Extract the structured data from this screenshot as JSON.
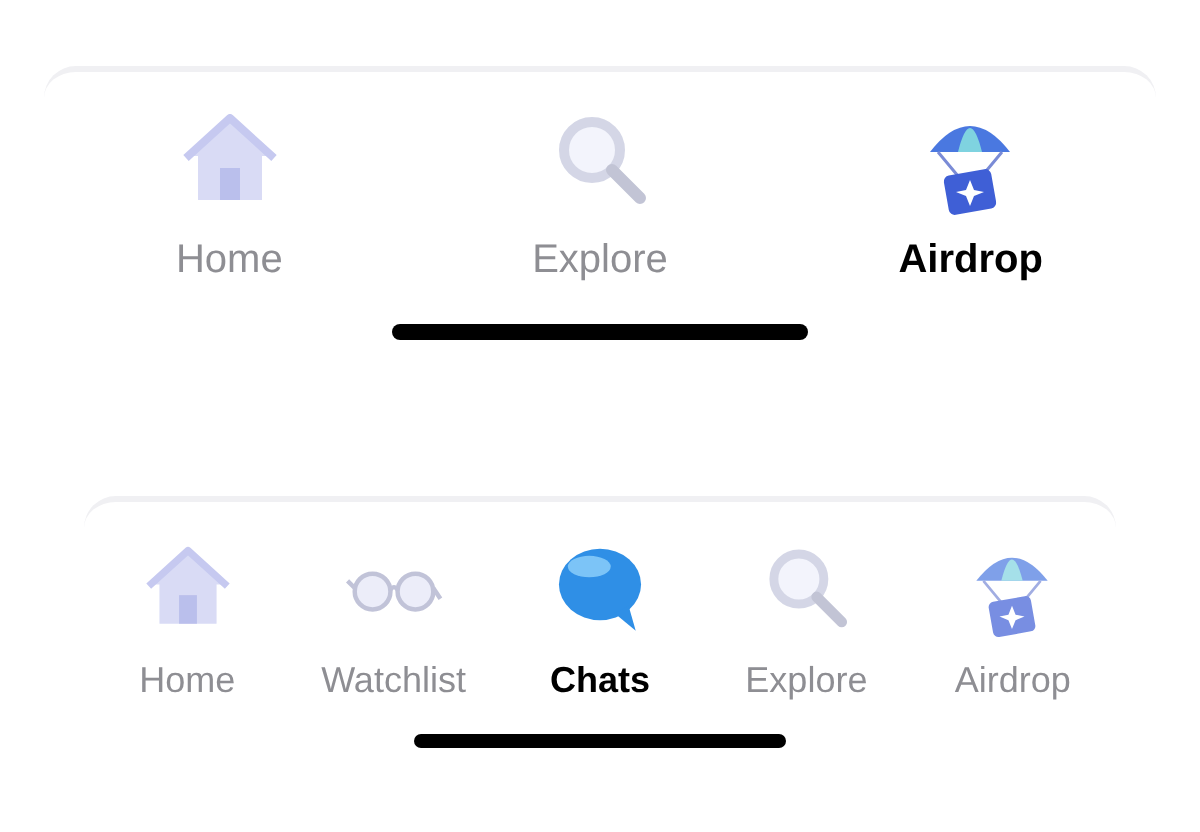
{
  "tab_bars": [
    {
      "tabs": [
        {
          "label": "Home",
          "kind": "home",
          "selected": false
        },
        {
          "label": "Explore",
          "kind": "search",
          "selected": false
        },
        {
          "label": "Airdrop",
          "kind": "parachute",
          "selected": true
        }
      ]
    },
    {
      "tabs": [
        {
          "label": "Home",
          "kind": "home",
          "selected": false
        },
        {
          "label": "Watchlist",
          "kind": "glasses",
          "selected": false
        },
        {
          "label": "Chats",
          "kind": "chat",
          "selected": true
        },
        {
          "label": "Explore",
          "kind": "search",
          "selected": false
        },
        {
          "label": "Airdrop",
          "kind": "parachute",
          "selected": false
        }
      ]
    }
  ]
}
